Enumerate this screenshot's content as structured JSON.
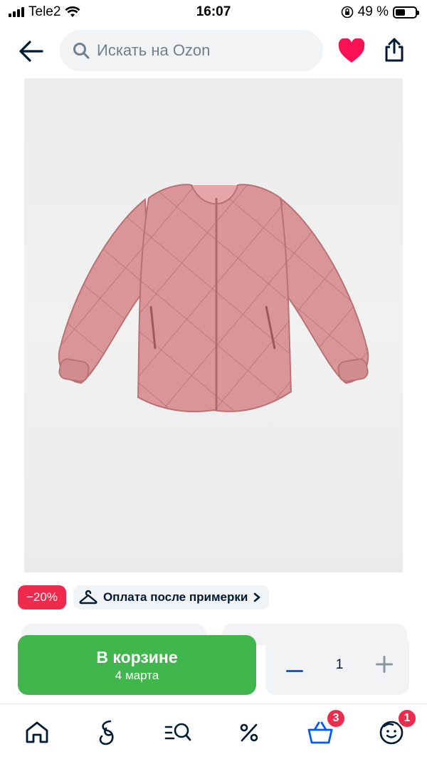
{
  "status_bar": {
    "carrier": "Tele2",
    "time": "16:07",
    "battery": "49 %"
  },
  "header": {
    "search_placeholder": "Искать на Ozon",
    "back_icon": "arrow-left-icon",
    "heart_icon": "heart-icon",
    "share_icon": "share-icon",
    "favorite_color": "#f91155"
  },
  "product": {
    "image_alt": "pink quilted jacket",
    "jacket_color": "#d99597"
  },
  "badges": {
    "discount": "−20%",
    "payment": "Оплата после примерки"
  },
  "actions": {
    "cart_label": "В корзине",
    "delivery_date": "4 марта",
    "quantity": "1",
    "cart_color": "#40b64c",
    "accent": "#005bff"
  },
  "tabbar": {
    "items": [
      {
        "icon": "home-icon"
      },
      {
        "icon": "ozon-fresh-icon"
      },
      {
        "icon": "catalog-search-icon"
      },
      {
        "icon": "percent-icon"
      },
      {
        "icon": "cart-icon",
        "badge": "3"
      },
      {
        "icon": "profile-icon",
        "badge": "1"
      }
    ]
  }
}
